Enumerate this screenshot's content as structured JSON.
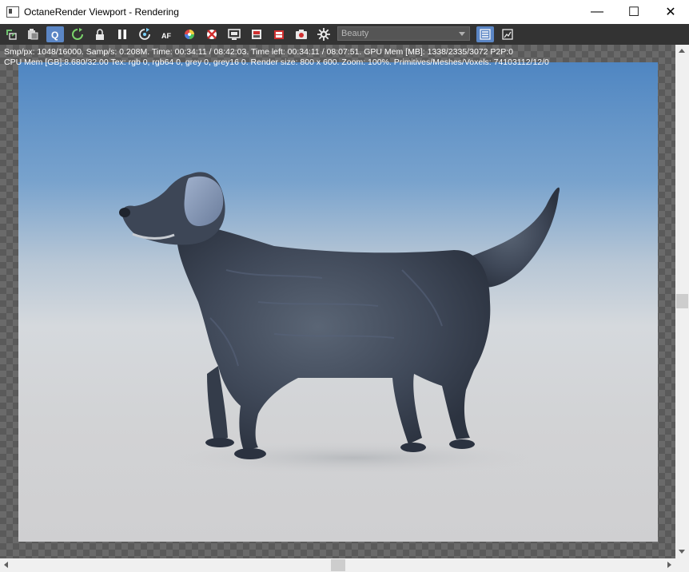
{
  "window": {
    "title": "OctaneRender Viewport - Rendering",
    "minimize_glyph": "—",
    "maximize_glyph": "☐",
    "close_glyph": "✕"
  },
  "toolbar": {
    "icons": [
      "recenter-icon",
      "copy-clipboard-icon",
      "quick-render-icon",
      "restart-render-icon",
      "lock-viewport-icon",
      "pause-render-icon",
      "reset-camera-icon",
      "auto-focus-icon",
      "color-picker-icon",
      "material-picker-icon",
      "screen-region-icon",
      "film-region-icon",
      "render-layer-icon",
      "snapshot-camera-icon",
      "settings-icon"
    ],
    "active_icon": "quick-render-icon",
    "quick_label": "Q",
    "af_label": "AF",
    "render_pass": "Beauty",
    "right_icons": [
      "list-view-icon",
      "image-view-icon"
    ]
  },
  "stats": {
    "line1": "Smp/px: 1048/16000.   Samp/s: 0.208M.   Time: 00:34:11 / 08:42:03.   Time left: 00:34:11 / 08:07:51.   GPU Mem [MB]: 1338/2335/3072 P2P:0",
    "line2": "CPU Mem [GB]:8.680/32.00   Tex: rgb 0, rgb64 0, grey 0, grey16 0.   Render size: 800 x 600.   Zoom: 100%.   Primitives/Meshes/Voxels: 74103112/12/0"
  },
  "colors": {
    "toolbar_bg": "#333333",
    "accent": "#5b86c5",
    "sky_top": "#4f86c2",
    "floor": "#d2d3d5"
  }
}
